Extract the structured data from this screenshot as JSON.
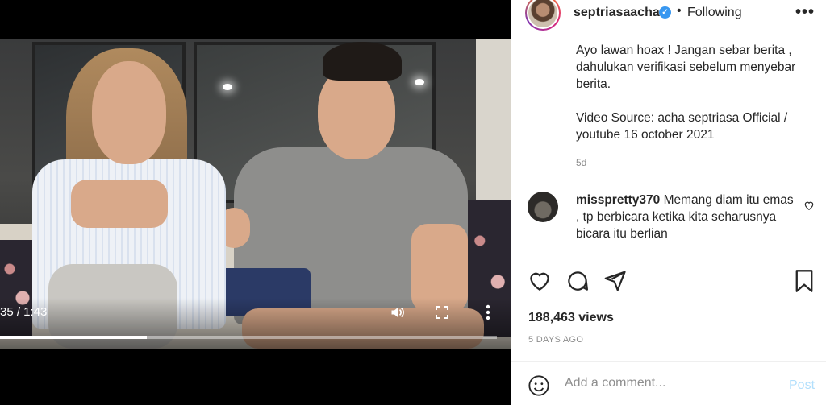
{
  "video": {
    "time_display": "35 / 1:43",
    "progress_fraction": 0.295
  },
  "post": {
    "username": "septriasaacha",
    "follow_status": "Following",
    "separator": "•",
    "more_label": "•••",
    "caption": "Ayo lawan hoax ! Jangan sebar berita , dahulukan verifikasi sebelum menyebar berita.\n\nVideo Source: acha septriasa Official / youtube 16 october 2021",
    "caption_age": "5d",
    "views": "188,463 views",
    "date": "5 DAYS AGO"
  },
  "comment": {
    "username": "misspretty370",
    "text": "Memang diam itu emas , tp berbicara ketika kita seharusnya bicara itu berlian"
  },
  "comment_box": {
    "placeholder": "Add a comment...",
    "post_label": "Post"
  },
  "colors": {
    "accent": "#3897f0",
    "post_disabled": "#b2dffc",
    "text": "#262626",
    "muted": "#8e8e8e"
  },
  "icons": {
    "like": "heart-icon",
    "comment": "comment-icon",
    "share": "share-icon",
    "save": "bookmark-icon",
    "emoji": "emoji-icon",
    "volume": "volume-icon",
    "fullscreen": "fullscreen-icon",
    "video_more": "vertical-dots-icon"
  }
}
